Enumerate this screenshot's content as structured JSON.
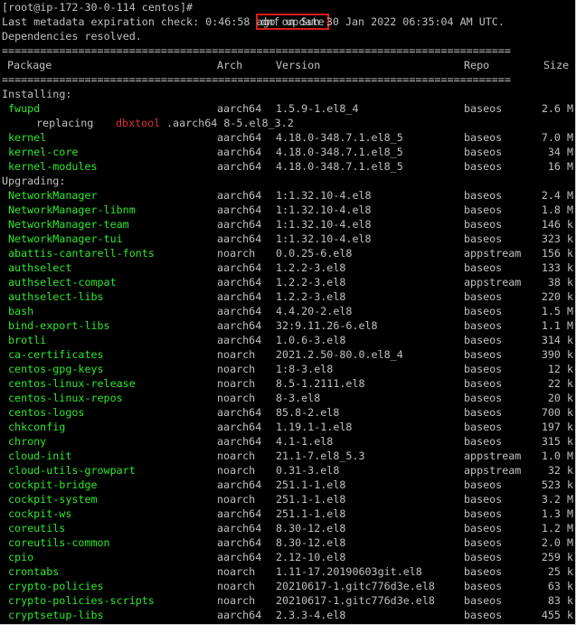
{
  "prompt": {
    "text": "[root@ip-172-30-0-114 centos]#",
    "command": "dnf update"
  },
  "metadata_line": "Last metadata expiration check: 0:46:58 ago on Sun 30 Jan 2022 06:35:04 AM UTC.",
  "deps_line": "Dependencies resolved.",
  "separator": "================================================================================",
  "header": {
    "package": "Package",
    "arch": "Arch",
    "version": "Version",
    "repo": "Repo",
    "size": "Size"
  },
  "installing_label": "Installing:",
  "installing": [
    {
      "name": "fwupd",
      "arch": "aarch64",
      "version": "1.5.9-1.el8_4",
      "repo": "baseos",
      "size": "2.6 M"
    }
  ],
  "replacing": {
    "word": "replacing",
    "pkg": "dbxtool",
    "rest": ".aarch64 8-5.el8_3.2"
  },
  "installing_more": [
    {
      "name": "kernel",
      "arch": "aarch64",
      "version": "4.18.0-348.7.1.el8_5",
      "repo": "baseos",
      "size": "7.0 M"
    },
    {
      "name": "kernel-core",
      "arch": "aarch64",
      "version": "4.18.0-348.7.1.el8_5",
      "repo": "baseos",
      "size": "34 M"
    },
    {
      "name": "kernel-modules",
      "arch": "aarch64",
      "version": "4.18.0-348.7.1.el8_5",
      "repo": "baseos",
      "size": "16 M"
    }
  ],
  "upgrading_label": "Upgrading:",
  "upgrading": [
    {
      "name": "NetworkManager",
      "arch": "aarch64",
      "version": "1:1.32.10-4.el8",
      "repo": "baseos",
      "size": "2.4 M"
    },
    {
      "name": "NetworkManager-libnm",
      "arch": "aarch64",
      "version": "1:1.32.10-4.el8",
      "repo": "baseos",
      "size": "1.8 M"
    },
    {
      "name": "NetworkManager-team",
      "arch": "aarch64",
      "version": "1:1.32.10-4.el8",
      "repo": "baseos",
      "size": "146 k"
    },
    {
      "name": "NetworkManager-tui",
      "arch": "aarch64",
      "version": "1:1.32.10-4.el8",
      "repo": "baseos",
      "size": "323 k"
    },
    {
      "name": "abattis-cantarell-fonts",
      "arch": "noarch",
      "version": "0.0.25-6.el8",
      "repo": "appstream",
      "size": "156 k"
    },
    {
      "name": "authselect",
      "arch": "aarch64",
      "version": "1.2.2-3.el8",
      "repo": "baseos",
      "size": "133 k"
    },
    {
      "name": "authselect-compat",
      "arch": "aarch64",
      "version": "1.2.2-3.el8",
      "repo": "appstream",
      "size": "38 k"
    },
    {
      "name": "authselect-libs",
      "arch": "aarch64",
      "version": "1.2.2-3.el8",
      "repo": "baseos",
      "size": "220 k"
    },
    {
      "name": "bash",
      "arch": "aarch64",
      "version": "4.4.20-2.el8",
      "repo": "baseos",
      "size": "1.5 M"
    },
    {
      "name": "bind-export-libs",
      "arch": "aarch64",
      "version": "32:9.11.26-6.el8",
      "repo": "baseos",
      "size": "1.1 M"
    },
    {
      "name": "brotli",
      "arch": "aarch64",
      "version": "1.0.6-3.el8",
      "repo": "baseos",
      "size": "314 k"
    },
    {
      "name": "ca-certificates",
      "arch": "noarch",
      "version": "2021.2.50-80.0.el8_4",
      "repo": "baseos",
      "size": "390 k"
    },
    {
      "name": "centos-gpg-keys",
      "arch": "noarch",
      "version": "1:8-3.el8",
      "repo": "baseos",
      "size": "12 k"
    },
    {
      "name": "centos-linux-release",
      "arch": "noarch",
      "version": "8.5-1.2111.el8",
      "repo": "baseos",
      "size": "22 k"
    },
    {
      "name": "centos-linux-repos",
      "arch": "noarch",
      "version": "8-3.el8",
      "repo": "baseos",
      "size": "20 k"
    },
    {
      "name": "centos-logos",
      "arch": "aarch64",
      "version": "85.8-2.el8",
      "repo": "baseos",
      "size": "700 k"
    },
    {
      "name": "chkconfig",
      "arch": "aarch64",
      "version": "1.19.1-1.el8",
      "repo": "baseos",
      "size": "197 k"
    },
    {
      "name": "chrony",
      "arch": "aarch64",
      "version": "4.1-1.el8",
      "repo": "baseos",
      "size": "315 k"
    },
    {
      "name": "cloud-init",
      "arch": "noarch",
      "version": "21.1-7.el8_5.3",
      "repo": "appstream",
      "size": "1.0 M"
    },
    {
      "name": "cloud-utils-growpart",
      "arch": "noarch",
      "version": "0.31-3.el8",
      "repo": "appstream",
      "size": "32 k"
    },
    {
      "name": "cockpit-bridge",
      "arch": "aarch64",
      "version": "251.1-1.el8",
      "repo": "baseos",
      "size": "523 k"
    },
    {
      "name": "cockpit-system",
      "arch": "noarch",
      "version": "251.1-1.el8",
      "repo": "baseos",
      "size": "3.2 M"
    },
    {
      "name": "cockpit-ws",
      "arch": "aarch64",
      "version": "251.1-1.el8",
      "repo": "baseos",
      "size": "1.3 M"
    },
    {
      "name": "coreutils",
      "arch": "aarch64",
      "version": "8.30-12.el8",
      "repo": "baseos",
      "size": "1.2 M"
    },
    {
      "name": "coreutils-common",
      "arch": "aarch64",
      "version": "8.30-12.el8",
      "repo": "baseos",
      "size": "2.0 M"
    },
    {
      "name": "cpio",
      "arch": "aarch64",
      "version": "2.12-10.el8",
      "repo": "baseos",
      "size": "259 k"
    },
    {
      "name": "crontabs",
      "arch": "noarch",
      "version": "1.11-17.20190603git.el8",
      "repo": "baseos",
      "size": "25 k"
    },
    {
      "name": "crypto-policies",
      "arch": "noarch",
      "version": "20210617-1.gitc776d3e.el8",
      "repo": "baseos",
      "size": "63 k"
    },
    {
      "name": "crypto-policies-scripts",
      "arch": "noarch",
      "version": "20210617-1.gitc776d3e.el8",
      "repo": "baseos",
      "size": "83 k"
    },
    {
      "name": "cryptsetup-libs",
      "arch": "aarch64",
      "version": "2.3.3-4.el8",
      "repo": "baseos",
      "size": "455 k"
    }
  ],
  "colors": {
    "background": "#000000",
    "text": "#c0c0c0",
    "package_name": "#2ee82e",
    "replaced_package": "#e03030",
    "highlight_box": "#e01a1a"
  }
}
